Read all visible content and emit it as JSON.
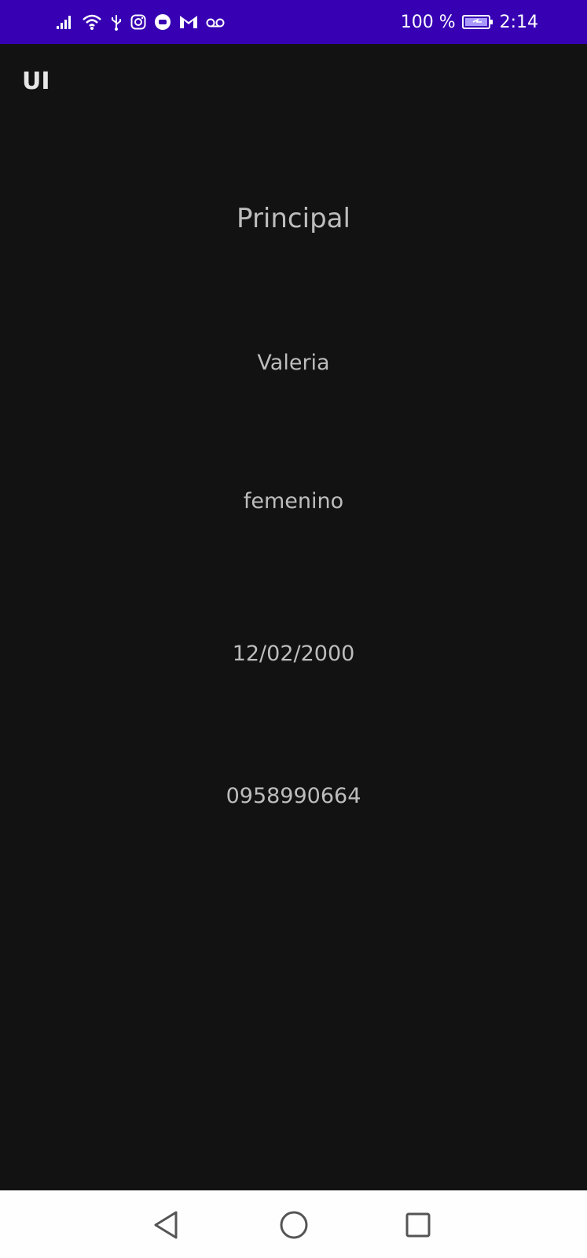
{
  "status_bar": {
    "battery": "100 %",
    "time": "2:14",
    "icons": [
      "signal-icon",
      "wifi-icon",
      "usb-icon",
      "instagram-icon",
      "messenger-icon",
      "gmail-icon",
      "voicemail-icon",
      "battery-icon"
    ]
  },
  "app_bar": {
    "title": "UI"
  },
  "main": {
    "heading": "Principal",
    "name": "Valeria",
    "gender": "femenino",
    "birthdate": "12/02/2000",
    "phone": "0958990664"
  },
  "nav_bar": {
    "icons": [
      "back-icon",
      "home-icon",
      "recent-apps-icon"
    ]
  },
  "colors": {
    "status_bar_bg": "#3700b3",
    "background": "#121212",
    "text": "#bdbdbd",
    "nav_bar_bg": "#fefefe"
  }
}
